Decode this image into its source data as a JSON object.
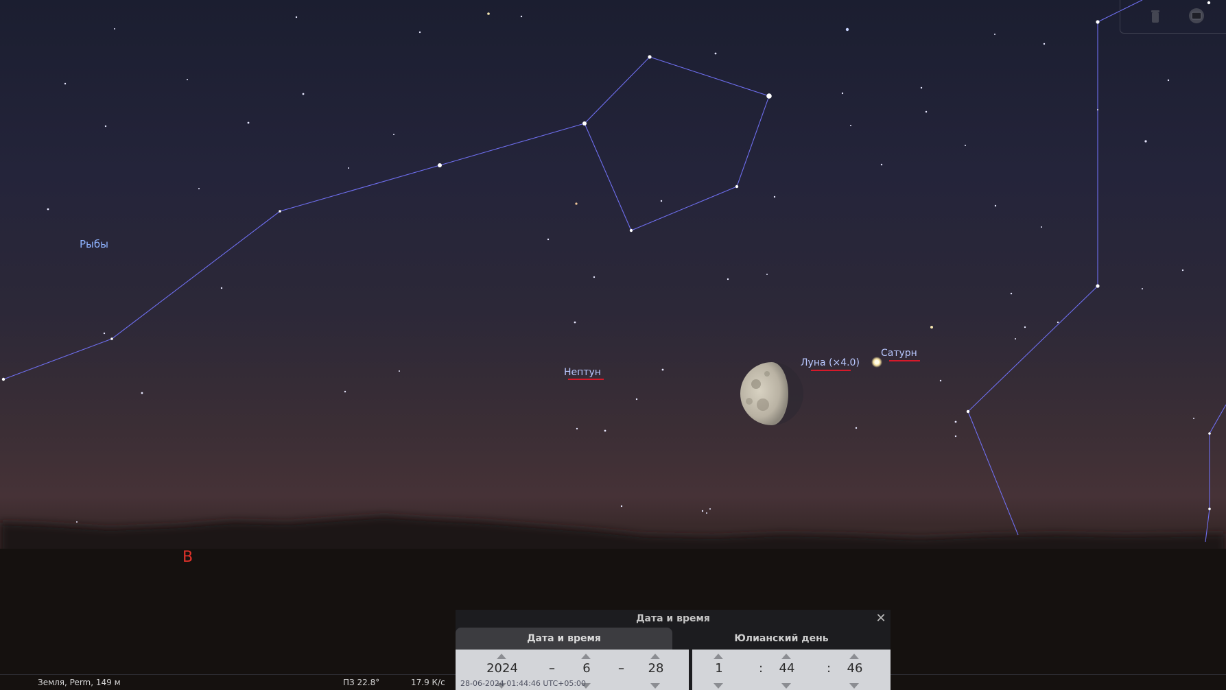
{
  "constellation": {
    "name": "Рыбы"
  },
  "planets": {
    "neptune": "Нептун",
    "moon": "Луна (×4.0)",
    "saturn": "Сатурн"
  },
  "direction_label": "В",
  "top_buttons": [
    {
      "icon": "trash-icon"
    },
    {
      "icon": "window-icon"
    }
  ],
  "statusbar": {
    "location": "Земля, Perm, 149 м",
    "fov": "ПЗ 22.8°",
    "fps": "17.9 К/с",
    "datetime": "28-06-2024 01:44:46 UTC+05:00"
  },
  "date_dialog": {
    "title": "Дата и время",
    "tabs": [
      "Дата и время",
      "Юлианский день"
    ],
    "active_tab": 0,
    "year": "2024",
    "month": "6",
    "day": "28",
    "hour": "1",
    "minute": "44",
    "second": "46",
    "date_separator": "–",
    "time_separator": ":"
  },
  "colors": {
    "constellation_lines": "#6f6ff0",
    "planet_marker": "#d6192a",
    "label_blue": "#8fb3ff",
    "direction_red": "#e2322a"
  }
}
